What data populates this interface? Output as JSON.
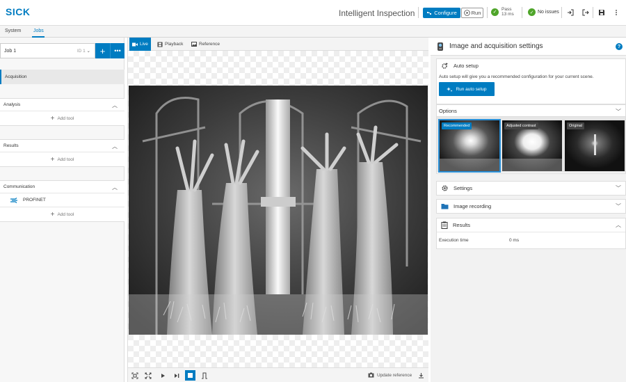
{
  "topbar": {
    "logo": "SICK",
    "app_title": "Intelligent Inspection",
    "configure_label": "Configure",
    "run_label": "Run",
    "pass_label": "Pass",
    "pass_time": "13 ms",
    "status_label": "No issues"
  },
  "main_tabs": [
    {
      "label": "System"
    },
    {
      "label": "Jobs"
    }
  ],
  "left": {
    "job_name": "Job 1",
    "job_id": "ID 1",
    "acquisition_label": "Acquisition",
    "sections": [
      {
        "title": "Analysis",
        "add_tool": "Add tool"
      },
      {
        "title": "Results",
        "add_tool": "Add tool"
      },
      {
        "title": "Communication",
        "item": "PROFINET",
        "add_tool": "Add tool"
      }
    ]
  },
  "center": {
    "tabs": [
      {
        "label": "Live"
      },
      {
        "label": "Playback"
      },
      {
        "label": "Reference"
      }
    ],
    "update_reference": "Update reference"
  },
  "right": {
    "title": "Image and acquisition settings",
    "auto_setup": {
      "title": "Auto setup",
      "description": "Auto setup will give you a recommended configuration for your current scene.",
      "button": "Run auto setup"
    },
    "options": {
      "title": "Options",
      "thumbs": [
        {
          "label": "Recommended"
        },
        {
          "label": "Adjusted contrast"
        },
        {
          "label": "Original"
        }
      ]
    },
    "settings_title": "Settings",
    "image_recording_title": "Image recording",
    "results": {
      "title": "Results",
      "rows": [
        {
          "label": "Execution time",
          "value": "0 ms"
        }
      ]
    }
  },
  "colors": {
    "accent": "#007cc1",
    "pass_green": "#4fa52a"
  }
}
